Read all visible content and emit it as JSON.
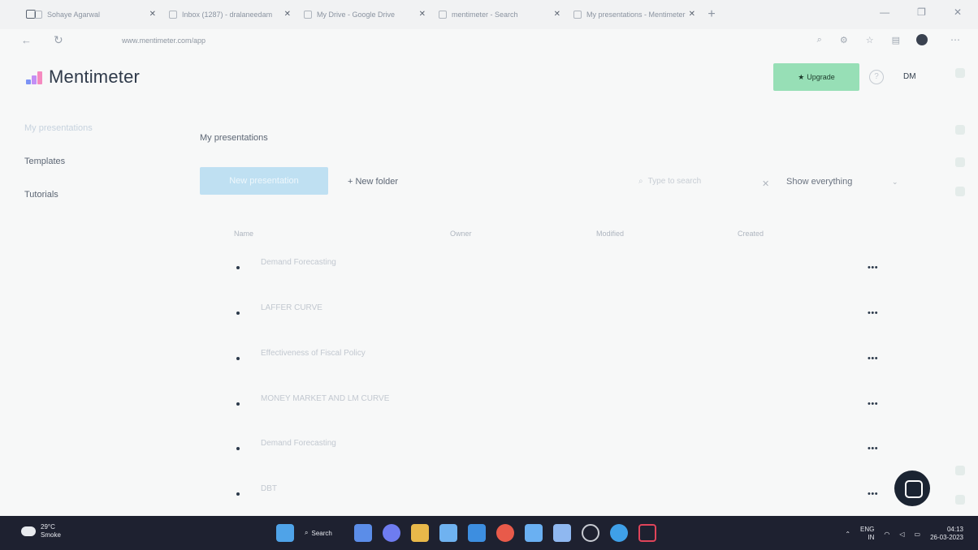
{
  "browser": {
    "tabs": [
      {
        "label": "Sohaye Agarwal"
      },
      {
        "label": "Inbox (1287) - dralaneedam"
      },
      {
        "label": "My Drive - Google Drive"
      },
      {
        "label": "mentimeter - Search"
      },
      {
        "label": "My presentations - Mentimeter"
      }
    ],
    "url": "www.mentimeter.com/app",
    "window_controls": {
      "minimize": "—",
      "maximize": "❐",
      "close": "✕"
    }
  },
  "header": {
    "logo_text": "Mentimeter",
    "upgrade_label": "Upgrade",
    "user_initials": "DM",
    "brand_colors": [
      "#7c93f5",
      "#c38ff5",
      "#f58ac0"
    ]
  },
  "sidebar": {
    "items": [
      {
        "label": "My presentations"
      },
      {
        "label": "Templates"
      },
      {
        "label": "Tutorials"
      }
    ]
  },
  "main": {
    "title": "My presentations",
    "new_presentation_label": "New presentation",
    "new_folder_label": "+ New folder",
    "search_placeholder": "Type to search",
    "filter_label": "Show everything",
    "columns": [
      "Name",
      "Owner",
      "Modified",
      "Created"
    ],
    "rows": [
      {
        "title": "Demand Forecasting"
      },
      {
        "title": "LAFFER CURVE"
      },
      {
        "title": "Effectiveness of Fiscal Policy"
      },
      {
        "title": "MONEY MARKET AND LM CURVE"
      },
      {
        "title": "Demand Forecasting"
      },
      {
        "title": "DBT"
      }
    ],
    "row_menu": "•••"
  },
  "taskbar": {
    "temperature": "29°C",
    "weather_desc": "Smoke",
    "search_label": "Search",
    "language": "ENG",
    "language_region": "IN",
    "time": "04:13",
    "date": "26-03-2023"
  }
}
